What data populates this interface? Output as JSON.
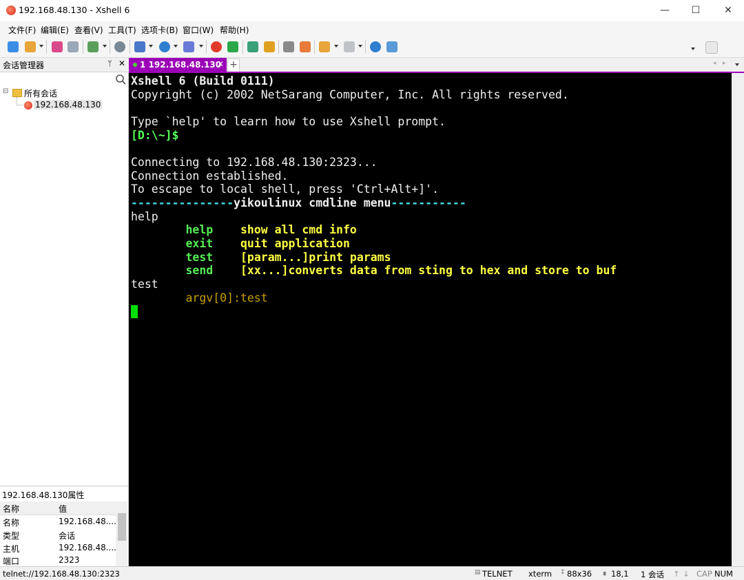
{
  "window": {
    "title": "192.168.48.130 - Xshell 6",
    "min": "—",
    "max": "☐",
    "close": "✕"
  },
  "menu": [
    "文件(F)",
    "编辑(E)",
    "查看(V)",
    "工具(T)",
    "选项卡(B)",
    "窗口(W)",
    "帮助(H)"
  ],
  "session_panel": {
    "title": "会话管理器",
    "pin": "ᛘ",
    "close": "✕",
    "tree": {
      "root": "所有会话",
      "child": "192.168.48.130",
      "expander": "⊟"
    }
  },
  "properties": {
    "title": "192.168.48.130属性",
    "header": [
      "名称",
      "值"
    ],
    "rows": [
      [
        "名称",
        "192.168.48...."
      ],
      [
        "类型",
        "会话"
      ],
      [
        "主机",
        "192.168.48...."
      ],
      [
        "端口",
        "2323"
      ]
    ]
  },
  "tab": {
    "label": "1 192.168.48.130",
    "close": "✕",
    "add": "+"
  },
  "terminal": {
    "lines": [
      "Xshell 6 (Build 0111)",
      "Copyright (c) 2002 NetSarang Computer, Inc. All rights reserved.",
      "",
      "Type `help' to learn how to use Xshell prompt.",
      "[D:\\~]$",
      "",
      "Connecting to 192.168.48.130:2323...",
      "Connection established.",
      "To escape to local shell, press 'Ctrl+Alt+]'.",
      "---------------yikoulinux cmdline menu-----------",
      "help",
      "        help    show all cmd info",
      "        exit    quit application",
      "        test    [param...]print params",
      "        send    [xx...]converts data from sting to hex and store to buf",
      "test",
      "        argv[0]:test"
    ],
    "colors": {
      "fg": "#f0f0f0",
      "prompt": "#55ff55",
      "banner": "#44ddee",
      "cmd": "#55ee55",
      "desc": "#ffff44",
      "argv": "#c8a000",
      "cursor": "#00e000"
    }
  },
  "status": {
    "connection": "telnet://192.168.48.130:2323",
    "protocol": "TELNET",
    "term": "xterm",
    "size": "88x36",
    "position": "18,1",
    "sessions": "1 会话",
    "cap": "CAP",
    "num": "NUM"
  }
}
